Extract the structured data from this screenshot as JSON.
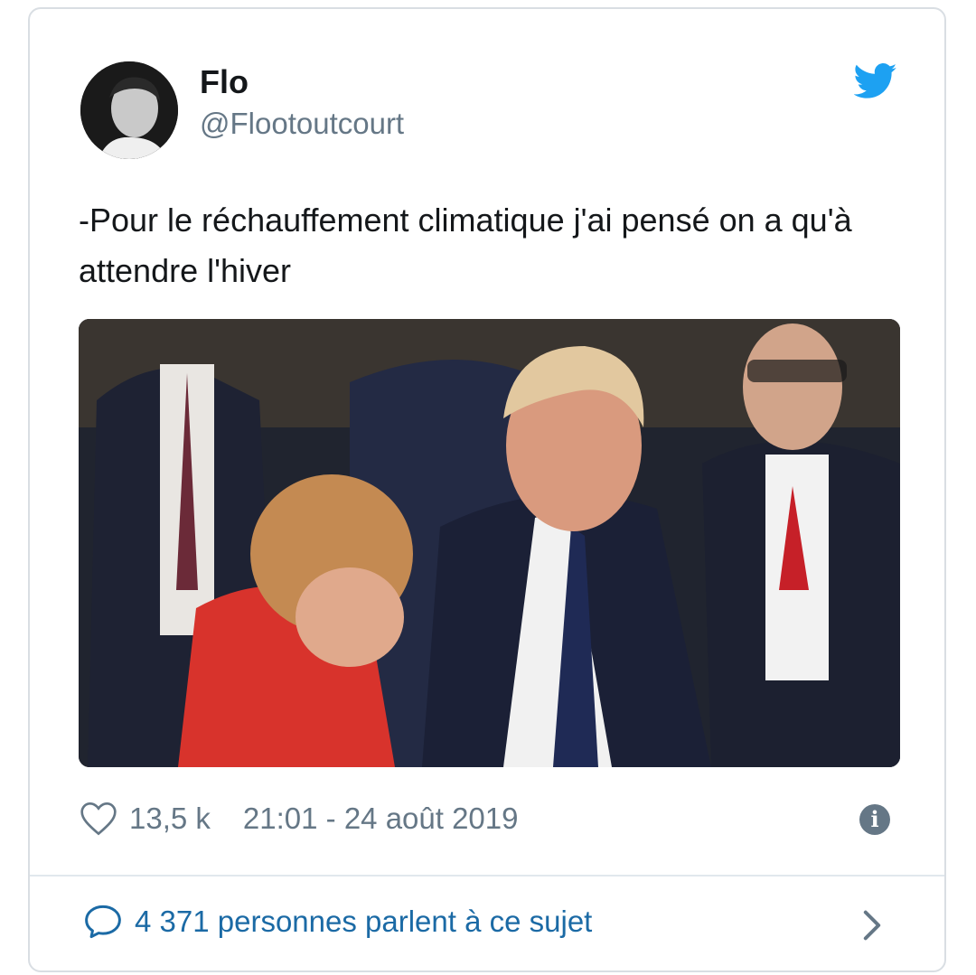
{
  "tweet": {
    "author_name": "Flo",
    "author_handle": "@Flootoutcourt",
    "text": "-Pour le réchauffement climatique j'ai pensé on a qu'à attendre l'hiver",
    "likes": "13,5 k",
    "timestamp": "21:01 - 24 août 2019",
    "conversation_label": "4 371 personnes parlent à ce sujet"
  },
  "colors": {
    "twitter_blue": "#1da1f2",
    "link_blue": "#1b6aa5",
    "secondary_text": "#657786",
    "border": "#d9dee3"
  },
  "icons": {
    "brand": "twitter-bird-icon",
    "like": "heart-icon",
    "info": "info-icon",
    "reply": "speech-bubble-icon",
    "more": "chevron-right-icon"
  }
}
